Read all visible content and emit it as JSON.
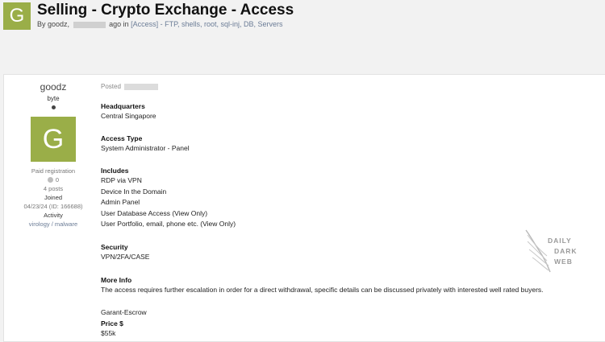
{
  "header": {
    "avatar_letter": "G",
    "title": "Selling - Crypto Exchange - Access",
    "meta_by": "By goodz,",
    "meta_ago": "ago in",
    "meta_category": "[Access] - FTP, shells, root, sql-inj, DB, Servers"
  },
  "author": {
    "username": "goodz",
    "rank": "byte",
    "avatar_letter": "G",
    "registration": "Paid registration",
    "reputation": "0",
    "posts": "4 posts",
    "joined_label": "Joined",
    "joined_value": "04/23/24 (ID: 166688)",
    "activity_label": "Activity",
    "activity_value": "virology / malware"
  },
  "post": {
    "posted_label": "Posted",
    "sections": {
      "headquarters": {
        "title": "Headquarters",
        "lines": [
          "Central Singapore"
        ]
      },
      "access_type": {
        "title": "Access Type",
        "lines": [
          "System Administrator - Panel"
        ]
      },
      "includes": {
        "title": "Includes",
        "lines": [
          "RDP via VPN",
          "Device In the Domain",
          "Admin Panel",
          "User Database Access (View Only)",
          "User Portfolio, email, phone etc. (View Only)"
        ]
      },
      "security": {
        "title": "Security",
        "lines": [
          "VPN/2FA/CASE"
        ]
      },
      "more_info": {
        "title": "More Info",
        "lines": [
          "The access requires further escalation in order for a direct withdrawal, specific details can be discussed privately with interested well rated buyers."
        ]
      }
    },
    "garant": "Garant-Escrow",
    "price_title": "Price $",
    "price_value": "$55k"
  },
  "watermark": {
    "line1": "DAILY",
    "line2": "DARK",
    "line3": "WEB"
  },
  "colors": {
    "avatar": "#9aae48",
    "category_link": "#6b7c96",
    "background": "#f2f2f2"
  }
}
